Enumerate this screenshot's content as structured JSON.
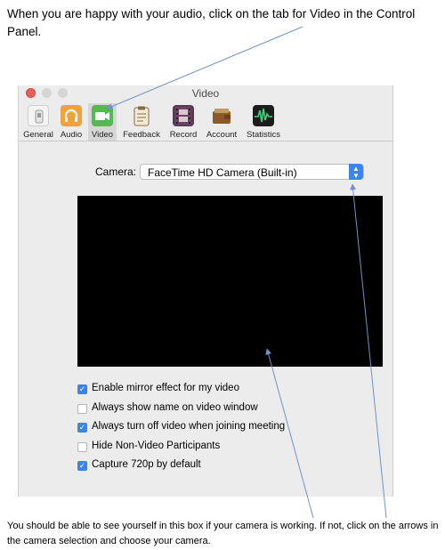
{
  "instructions": {
    "top": "When you are happy with your audio, click on the tab for Video in the Control Panel.",
    "bottom": "You should be able to see yourself in this box if your camera is working.  If not, click on the arrows in the camera selection and choose your camera."
  },
  "window": {
    "title": "Video",
    "toolbar": [
      {
        "label": "General",
        "icon": "general-switch-icon"
      },
      {
        "label": "Audio",
        "icon": "audio-headphones-icon"
      },
      {
        "label": "Video",
        "icon": "video-camera-icon",
        "selected": true
      },
      {
        "label": "Feedback",
        "icon": "feedback-clipboard-icon"
      },
      {
        "label": "Record",
        "icon": "record-filmstrip-icon"
      },
      {
        "label": "Account",
        "icon": "account-wallet-icon"
      },
      {
        "label": "Statistics",
        "icon": "statistics-waveform-icon"
      }
    ],
    "camera": {
      "label": "Camera:",
      "value": "FaceTime HD Camera (Built-in)"
    },
    "options": [
      {
        "label": "Enable mirror effect for my video",
        "checked": true
      },
      {
        "label": "Always show name on video window",
        "checked": false
      },
      {
        "label": "Always turn off video when joining meeting",
        "checked": true
      },
      {
        "label": "Hide Non-Video Participants",
        "checked": false
      },
      {
        "label": "Capture 720p by default",
        "checked": true
      }
    ]
  },
  "colors": {
    "accent_blue": "#3b84f0",
    "close_red": "#ee5c56",
    "video_green": "#54b94e",
    "audio_orange": "#f0a33a",
    "annotation_line": "#6f94c8"
  }
}
